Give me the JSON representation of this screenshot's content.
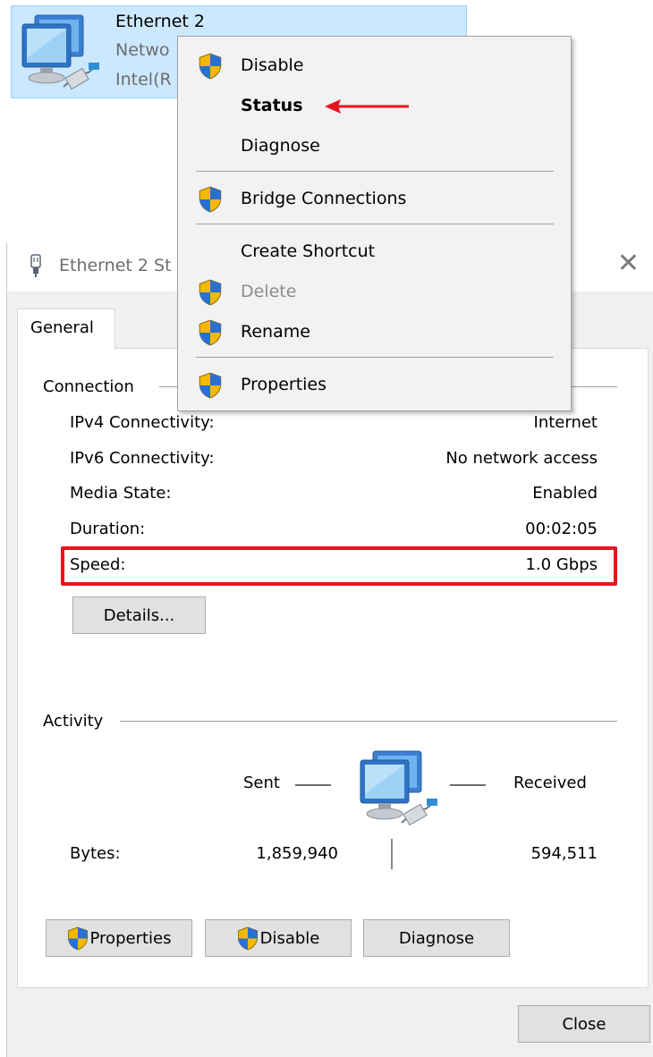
{
  "adapter": {
    "name": "Ethernet 2",
    "line2": "Netwo",
    "line3": "Intel(R"
  },
  "dialog": {
    "title": "Ethernet 2 St",
    "close_glyph": "✕",
    "tab": "General",
    "connection": {
      "heading": "Connection",
      "rows": [
        {
          "label": "IPv4 Connectivity:",
          "value": "Internet"
        },
        {
          "label": "IPv6 Connectivity:",
          "value": "No network access"
        },
        {
          "label": "Media State:",
          "value": "Enabled"
        },
        {
          "label": "Duration:",
          "value": "00:02:05"
        },
        {
          "label": "Speed:",
          "value": "1.0 Gbps"
        }
      ],
      "details_button": "Details..."
    },
    "activity": {
      "heading": "Activity",
      "sent_label": "Sent",
      "received_label": "Received",
      "bytes_label": "Bytes:",
      "bytes_sent": "1,859,940",
      "bytes_received": "594,511"
    },
    "buttons": {
      "properties": "Properties",
      "disable": "Disable",
      "diagnose": "Diagnose",
      "close": "Close"
    }
  },
  "context_menu": {
    "items": [
      {
        "label": "Disable",
        "icon": "uac-shield-icon",
        "enabled": true
      },
      {
        "label": "Status",
        "icon": "",
        "enabled": true,
        "bold": true
      },
      {
        "label": "Diagnose",
        "icon": "",
        "enabled": true
      },
      {
        "label": "Bridge Connections",
        "icon": "uac-shield-icon",
        "enabled": true
      },
      {
        "label": "Create Shortcut",
        "icon": "",
        "enabled": true
      },
      {
        "label": "Delete",
        "icon": "uac-shield-icon",
        "enabled": false
      },
      {
        "label": "Rename",
        "icon": "uac-shield-icon",
        "enabled": true
      },
      {
        "label": "Properties",
        "icon": "uac-shield-icon",
        "enabled": true
      }
    ]
  },
  "annotations": {
    "highlight_color": "#e8141e",
    "arrow_color": "#e8141e"
  },
  "colors": {
    "selection_bg": "#cce8ff",
    "dialog_bg": "#f0f0f0",
    "button_bg": "#e1e1e1"
  }
}
